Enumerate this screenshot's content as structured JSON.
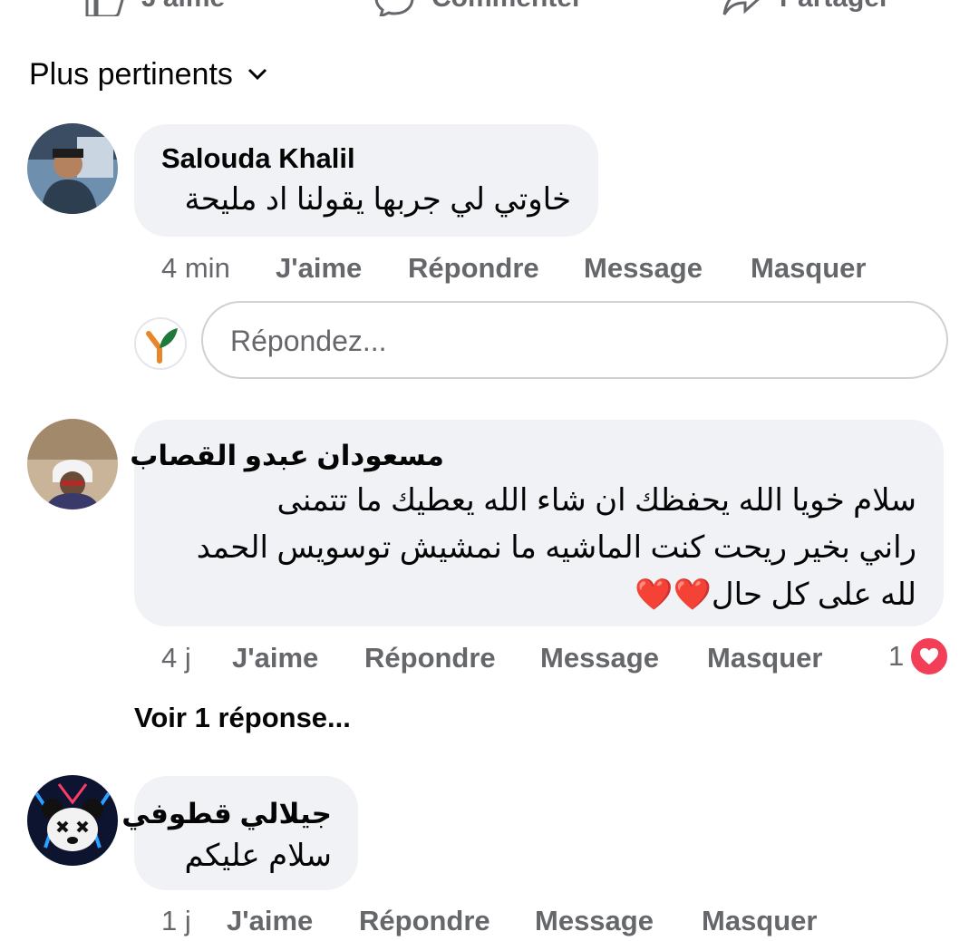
{
  "top_bar": {
    "like_label": "J'aime",
    "comment_label": "Commenter",
    "share_label": "Partager"
  },
  "sort": {
    "label": "Plus pertinents"
  },
  "reply_input": {
    "placeholder": "Répondez..."
  },
  "comments": [
    {
      "author": "Salouda Khalil",
      "text": "خاوتي لي جربها يقولنا اد مليحة",
      "time": "4 min",
      "like": "J'aime",
      "reply": "Répondre",
      "message": "Message",
      "hide": "Masquer"
    },
    {
      "author": "مسعودان عبدو القصاب",
      "lines": [
        "سلام خويا الله يحفظك ان شاء الله يعطيك ما تتمنى",
        "راني بخير ريحت كنت الماشيه ما نمشيش توسويس الحمد",
        "لله على كل حال❤️❤️"
      ],
      "time": "4 j",
      "like": "J'aime",
      "reply": "Répondre",
      "message": "Message",
      "hide": "Masquer",
      "reaction_count": "1",
      "see_replies": "Voir 1 réponse..."
    },
    {
      "author": "جيلالي قطوفي",
      "text": "سلام عليكم",
      "time": "1 j",
      "like": "J'aime",
      "reply": "Répondre",
      "message": "Message",
      "hide": "Masquer"
    }
  ],
  "colors": {
    "bubble": "#f0f2f5",
    "secondary_text": "#65676b",
    "love_reaction": "#f33e58"
  }
}
